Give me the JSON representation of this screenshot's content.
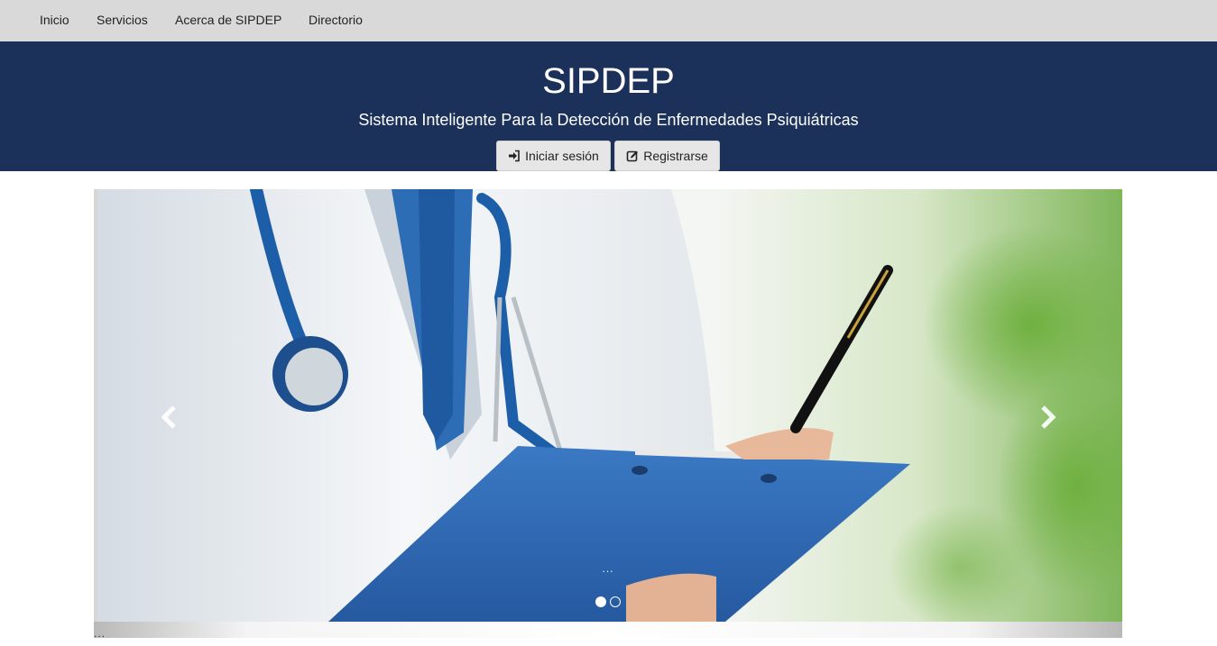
{
  "nav": {
    "items": [
      {
        "label": "Inicio"
      },
      {
        "label": "Servicios"
      },
      {
        "label": "Acerca de SIPDEP"
      },
      {
        "label": "Directorio"
      }
    ]
  },
  "header": {
    "title": "SIPDEP",
    "subtitle": "Sistema Inteligente Para la Detección de Enfermedades Psiquiátricas",
    "login_label": "Iniciar sesión",
    "register_label": "Registrarse"
  },
  "carousel": {
    "caption": "...",
    "slide_count": 2,
    "active_slide": 1,
    "below_text": "..."
  },
  "colors": {
    "nav_bg": "#d9d9d9",
    "header_bg": "#1c3159",
    "button_bg": "#e6e6e6"
  },
  "icons": [
    "sign-in-icon",
    "edit-icon",
    "chevron-left-icon",
    "chevron-right-icon"
  ]
}
